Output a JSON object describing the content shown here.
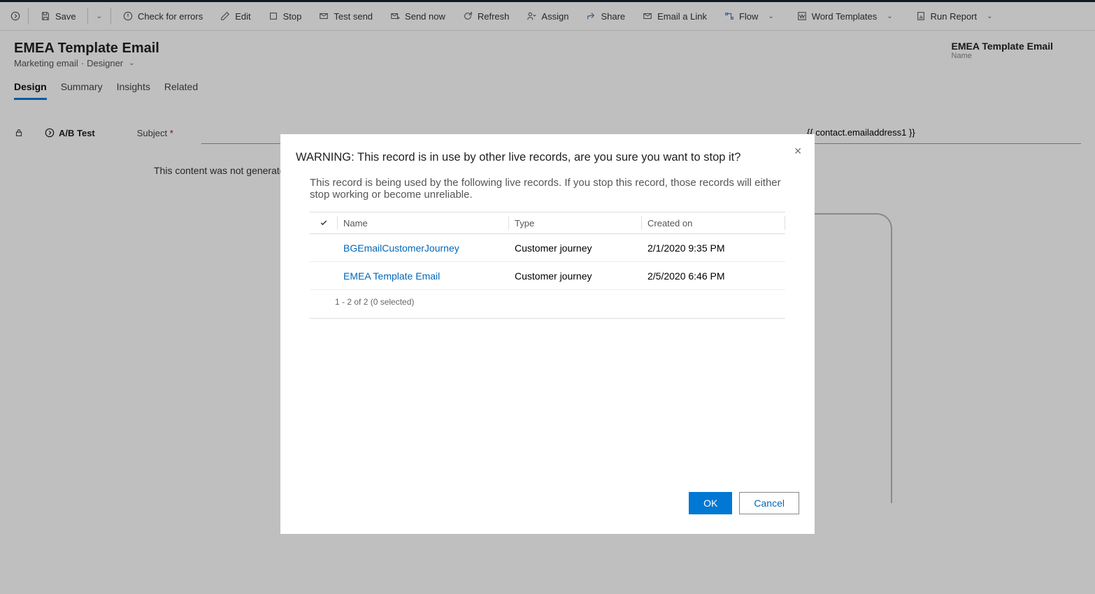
{
  "commandBar": {
    "save": "Save",
    "checkErrors": "Check for errors",
    "edit": "Edit",
    "stop": "Stop",
    "testSend": "Test send",
    "sendNow": "Send now",
    "refresh": "Refresh",
    "assign": "Assign",
    "share": "Share",
    "emailLink": "Email a Link",
    "flow": "Flow",
    "wordTemplates": "Word Templates",
    "runReport": "Run Report"
  },
  "header": {
    "title": "EMEA Template Email",
    "subEntity": "Marketing email",
    "subView": "Designer",
    "rightTitle": "EMEA Template Email",
    "rightSub": "Name"
  },
  "tabs": {
    "design": "Design",
    "summary": "Summary",
    "insights": "Insights",
    "related": "Related"
  },
  "form": {
    "abTest": "A/B Test",
    "subjectLabel": "Subject",
    "toValue": "{{ contact.emailaddress1 }}",
    "notice": "This content was not generated for the advanced preview and may appear differently, depending on which email client and screen size they use."
  },
  "dialog": {
    "title": "WARNING: This record is in use by other live records, are you sure you want to stop it?",
    "desc": "This record is being used by the following live records. If you stop this record, those records will either stop working or become unreliable.",
    "columns": {
      "name": "Name",
      "type": "Type",
      "created": "Created on"
    },
    "rows": [
      {
        "name": "BGEmailCustomerJourney",
        "type": "Customer journey",
        "created": "2/1/2020 9:35 PM"
      },
      {
        "name": "EMEA Template Email",
        "type": "Customer journey",
        "created": "2/5/2020 6:46 PM"
      }
    ],
    "footer": "1 - 2 of 2 (0 selected)",
    "ok": "OK",
    "cancel": "Cancel"
  }
}
